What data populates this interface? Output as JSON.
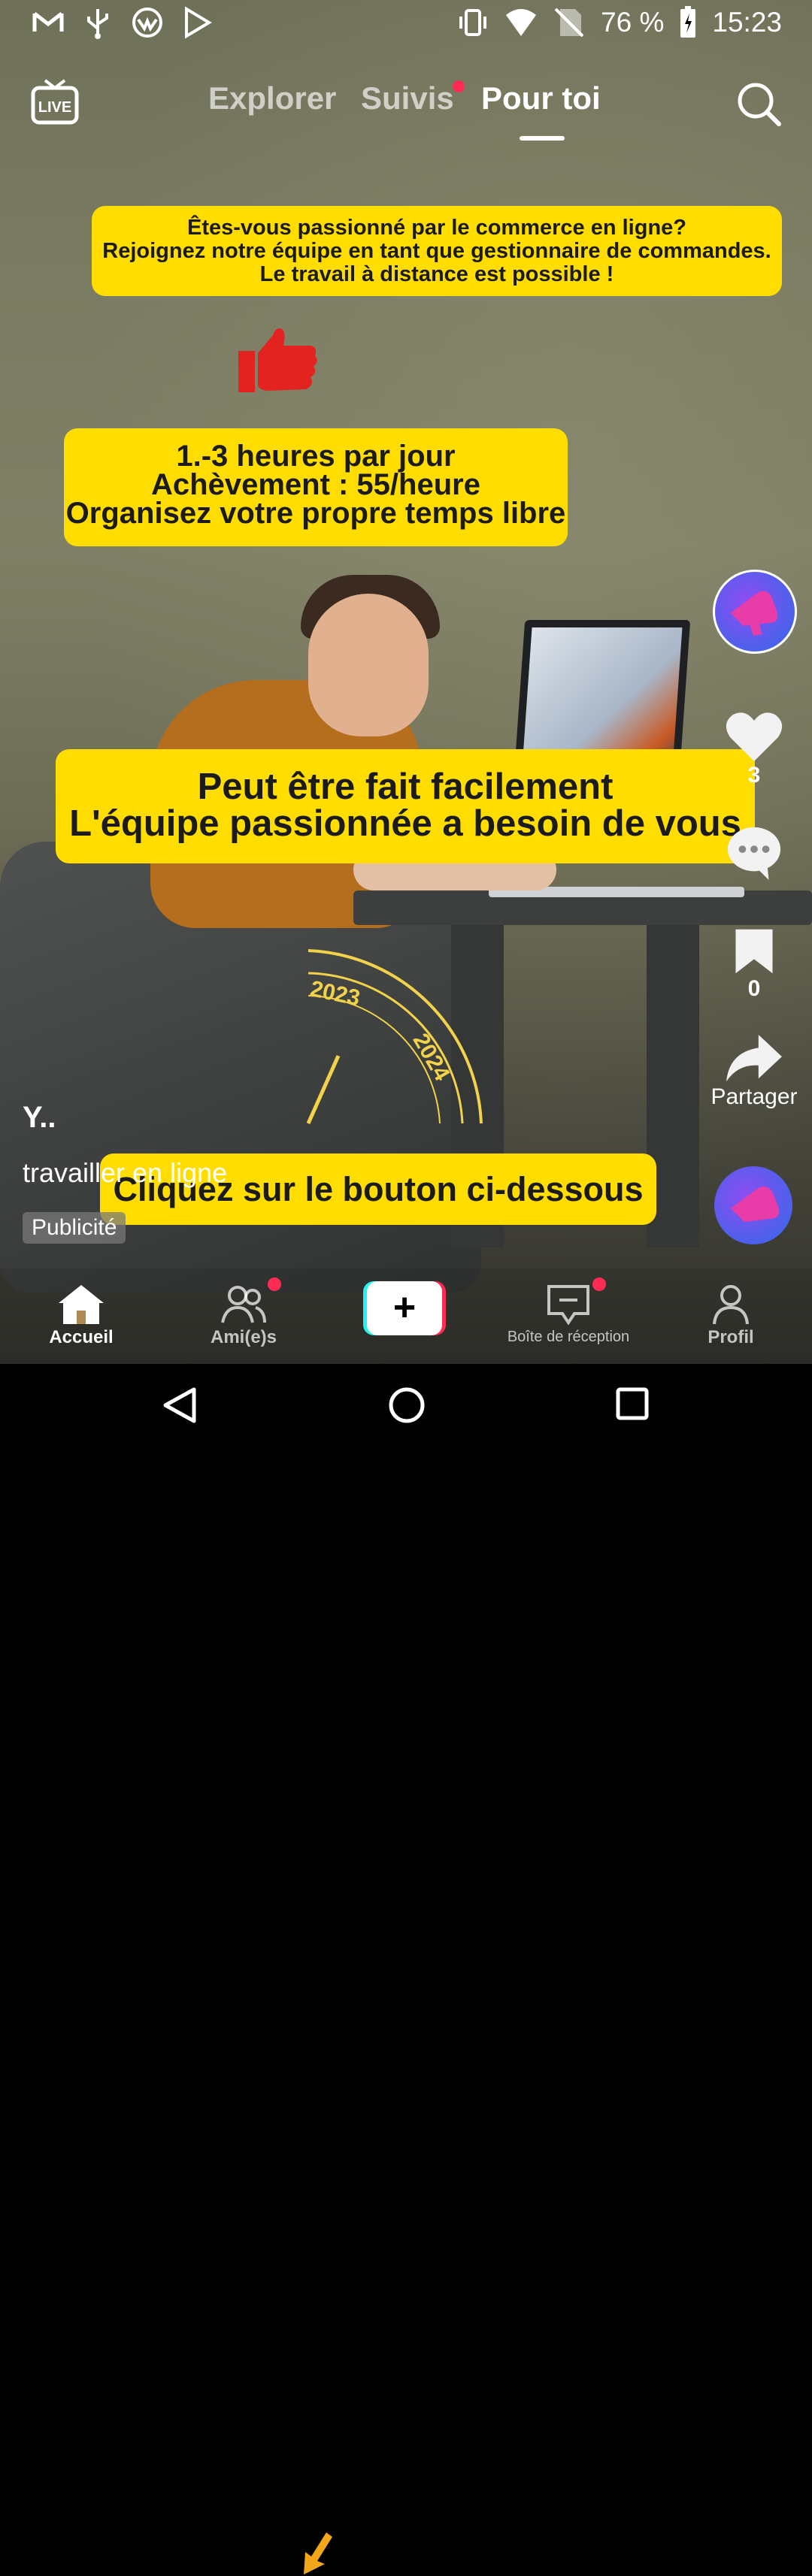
{
  "status_bar": {
    "battery": "76 %",
    "time": "15:23",
    "left_icons": [
      "gmail-icon",
      "usb-icon",
      "app-icon",
      "play-store-icon"
    ],
    "right_icons": [
      "vibrate-icon",
      "wifi-icon",
      "no-sim-icon",
      "battery-charging-icon"
    ]
  },
  "top_nav": {
    "live_label": "LIVE",
    "tabs": [
      {
        "label": "Explorer",
        "active": false
      },
      {
        "label": "Suivis",
        "active": false,
        "notification_dot": true
      },
      {
        "label": "Pour toi",
        "active": true
      }
    ]
  },
  "video": {
    "banner1": {
      "line1": "Êtes-vous passionné par le commerce en ligne?",
      "line2": "Rejoignez notre équipe en tant que gestionnaire de commandes.",
      "line3": "Le travail à distance est possible !"
    },
    "banner2": {
      "line1": "1.-3 heures par jour",
      "line2": "Achèvement : 55/heure",
      "line3": "Organisez votre propre temps libre"
    },
    "banner3": {
      "line1": "Peut être fait facilement",
      "line2": "L'équipe passionnée a besoin de vous"
    },
    "gauge": {
      "label_a": "2023",
      "label_b": "2024"
    },
    "banner4": "Cliquez sur le bouton ci-dessous"
  },
  "right_rail": {
    "likes": "3",
    "saves": "0",
    "share_label": "Partager"
  },
  "caption": {
    "username": "Y..",
    "text": "travailler en ligne",
    "ad_badge": "Publicité"
  },
  "bottom_nav": {
    "items": [
      {
        "label": "Accueil",
        "active": true
      },
      {
        "label": "Ami(e)s",
        "active": false,
        "notification_dot": true
      },
      {
        "label": "+",
        "active": false
      },
      {
        "label": "Boîte de réception",
        "active": false,
        "notification_dot": true
      },
      {
        "label": "Profil",
        "active": false
      }
    ]
  },
  "colors": {
    "banner": "#ffdd00",
    "accent_red": "#fe2c55",
    "accent_cyan": "#25f4ee"
  }
}
